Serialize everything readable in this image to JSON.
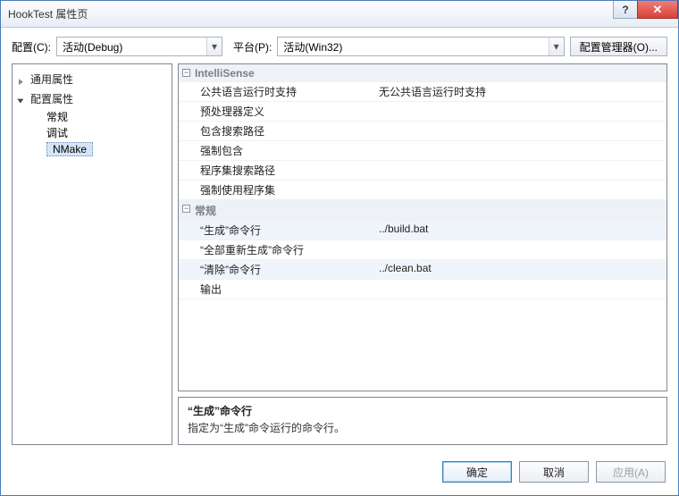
{
  "window": {
    "title": "HookTest 属性页"
  },
  "toolbar": {
    "config_label": "配置(C):",
    "config_value": "活动(Debug)",
    "platform_label": "平台(P):",
    "platform_value": "活动(Win32)",
    "config_manager": "配置管理器(O)..."
  },
  "tree": {
    "common": "通用属性",
    "config": "配置属性",
    "children": [
      "常规",
      "调试",
      "NMake"
    ],
    "selected_index": 2
  },
  "groups": [
    {
      "name": "IntelliSense",
      "rows": [
        {
          "label": "公共语言运行时支持",
          "value": "无公共语言运行时支持"
        },
        {
          "label": "预处理器定义",
          "value": ""
        },
        {
          "label": "包含搜索路径",
          "value": ""
        },
        {
          "label": "强制包含",
          "value": ""
        },
        {
          "label": "程序集搜索路径",
          "value": ""
        },
        {
          "label": "强制使用程序集",
          "value": ""
        }
      ]
    },
    {
      "name": "常规",
      "rows": [
        {
          "label": "“生成”命令行",
          "value": "../build.bat",
          "alt": true
        },
        {
          "label": "“全部重新生成”命令行",
          "value": ""
        },
        {
          "label": "“清除”命令行",
          "value": "../clean.bat",
          "alt": true
        },
        {
          "label": "输出",
          "value": ""
        }
      ]
    }
  ],
  "desc": {
    "title": "“生成”命令行",
    "text": "指定为“生成”命令运行的命令行。"
  },
  "footer": {
    "ok": "确定",
    "cancel": "取消",
    "apply": "应用(A)"
  }
}
